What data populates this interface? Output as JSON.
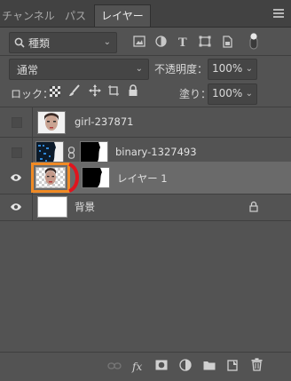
{
  "tabs": {
    "channels": "チャンネル",
    "paths": "パス",
    "layers": "レイヤー"
  },
  "filter": {
    "kind_label": "種類"
  },
  "blend": {
    "mode": "通常",
    "opacity_label": "不透明度：",
    "opacity_value": "100%"
  },
  "lock": {
    "label": "ロック：",
    "fill_label": "塗り：",
    "fill_value": "100%"
  },
  "layers": [
    {
      "name": "girl-237871",
      "visible": false
    },
    {
      "name": "binary-1327493",
      "visible": false
    },
    {
      "name": "レイヤー 1",
      "visible": true
    },
    {
      "name": "背景",
      "visible": true
    }
  ],
  "colors": {
    "highlight_orange": "#f08a24",
    "highlight_red": "#e0141e",
    "panel_bg": "#535353",
    "selected_row": "#6a6a6a"
  }
}
